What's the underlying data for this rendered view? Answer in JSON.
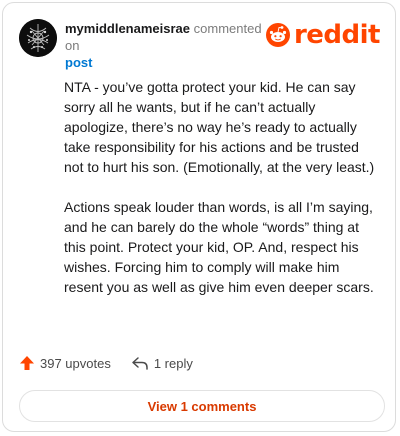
{
  "comment": {
    "username": "mymiddlenameisrae",
    "action_text": "commented on",
    "post_link": "post",
    "paragraphs": [
      "NTA - you’ve gotta protect your kid. He can say sorry all he wants, but if he can’t actually apologize, there’s no way he’s ready to actually take responsibility for his actions and be trusted not to hurt his son. (Emotionally, at the very least.)",
      "Actions speak louder than words, is all I’m saying, and he can barely do the whole “words” thing at this point. Protect your kid, OP. And, respect his wishes. Forcing him to comply will make him resent you as well as give him even deeper scars."
    ],
    "upvotes_label": "397 upvotes",
    "replies_label": "1 reply",
    "view_comments_label": "View 1 comments"
  },
  "brand": {
    "wordmark": "reddit",
    "color": "#ff4500"
  },
  "icons": {
    "avatar": "avatar-image",
    "upvote": "upvote-arrow-icon",
    "reply": "reply-arrow-icon",
    "logo": "reddit-alien-icon"
  }
}
